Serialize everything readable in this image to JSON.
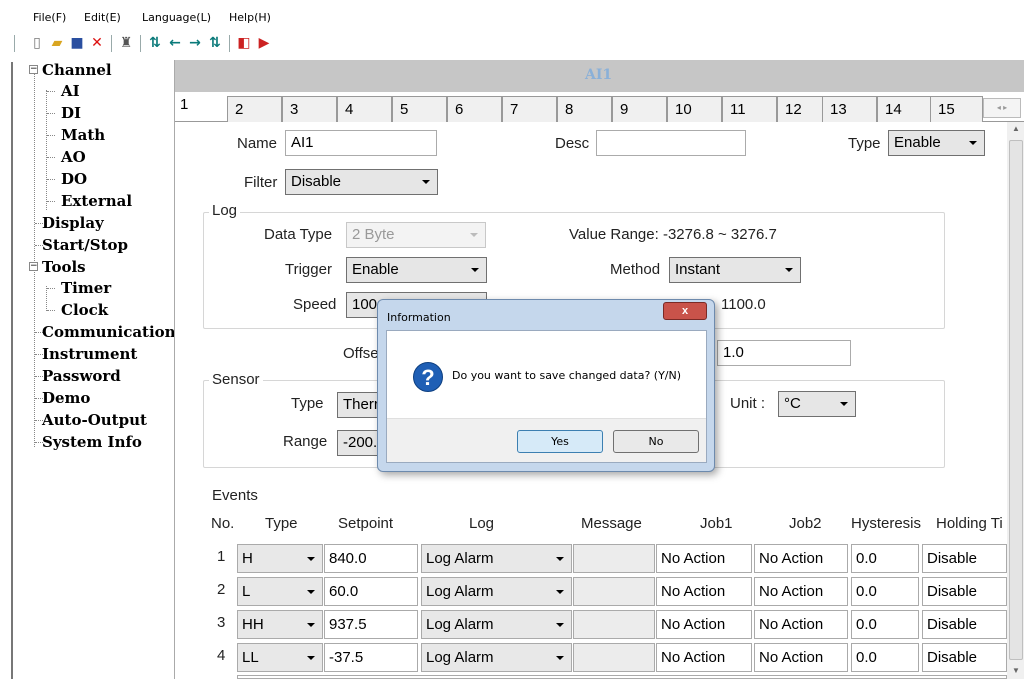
{
  "menubar": {
    "file": "File(F)",
    "edit": "Edit(E)",
    "language": "Language(L)",
    "help": "Help(H)"
  },
  "toolbar": {
    "icons": [
      "new-file-icon",
      "open-folder-icon",
      "save-icon",
      "delete-icon",
      "users-icon",
      "download-icon",
      "arrow-left-icon",
      "arrow-right-icon",
      "upload-icon",
      "import-icon",
      "export-icon"
    ]
  },
  "tree": {
    "channel": "Channel",
    "ai": "AI",
    "di": "DI",
    "math": "Math",
    "ao": "AO",
    "do": "DO",
    "external": "External",
    "display": "Display",
    "startstop": "Start/Stop",
    "tools": "Tools",
    "timer": "Timer",
    "clock": "Clock",
    "communication": "Communication",
    "instrument": "Instrument",
    "password": "Password",
    "demo": "Demo",
    "autooutput": "Auto-Output",
    "sysinfo": "System Info",
    "collapse_glyph": "−"
  },
  "panel": {
    "title": "AI1"
  },
  "tabs": [
    "1",
    "2",
    "3",
    "4",
    "5",
    "6",
    "7",
    "8",
    "9",
    "10",
    "11",
    "12",
    "13",
    "14",
    "15"
  ],
  "form": {
    "name_label": "Name",
    "name_value": "AI1",
    "desc_label": "Desc",
    "desc_value": "",
    "type_label": "Type",
    "type_value": "Enable",
    "filter_label": "Filter",
    "filter_value": "Disable"
  },
  "log": {
    "title": "Log",
    "datatype_label": "Data Type",
    "datatype_value": "2 Byte",
    "valuerange_text": "Value Range: -3276.8 ~ 3276.7",
    "trigger_label": "Trigger",
    "trigger_value": "Enable",
    "method_label": "Method",
    "method_value": "Instant",
    "speed_label": "Speed",
    "speed_value": "100",
    "modbus_partial": "1100.0"
  },
  "offset": {
    "label": "Offse",
    "value": "1.0"
  },
  "sensor": {
    "title": "Sensor",
    "type_label": "Type",
    "type_value": "Therr",
    "range_label": "Range",
    "range_value": "-200.",
    "unit_label": "Unit :",
    "unit_value": "°C"
  },
  "events": {
    "title": "Events",
    "headers": {
      "no": "No.",
      "type": "Type",
      "setpoint": "Setpoint",
      "log": "Log",
      "message": "Message",
      "job1": "Job1",
      "job2": "Job2",
      "hysteresis": "Hysteresis",
      "holding": "Holding Ti"
    },
    "rows": [
      {
        "no": "1",
        "type": "H",
        "setpoint": "840.0",
        "log": "Log Alarm",
        "job1": "No Action",
        "job2": "No Action",
        "hysteresis": "0.0",
        "holding": "Disable"
      },
      {
        "no": "2",
        "type": "L",
        "setpoint": "60.0",
        "log": "Log Alarm",
        "job1": "No Action",
        "job2": "No Action",
        "hysteresis": "0.0",
        "holding": "Disable"
      },
      {
        "no": "3",
        "type": "HH",
        "setpoint": "937.5",
        "log": "Log Alarm",
        "job1": "No Action",
        "job2": "No Action",
        "hysteresis": "0.0",
        "holding": "Disable"
      },
      {
        "no": "4",
        "type": "LL",
        "setpoint": "-37.5",
        "log": "Log Alarm",
        "job1": "No Action",
        "job2": "No Action",
        "hysteresis": "0.0",
        "holding": "Disable"
      }
    ]
  },
  "dialog": {
    "title": "Information",
    "close": "x",
    "icon": "question-icon",
    "icon_glyph": "?",
    "message": "Do you want to save changed data? (Y/N)",
    "yes": "Yes",
    "no": "No"
  },
  "colors": {
    "dialog_frame": "#c5d7ec",
    "close_button": "#c9534a",
    "panel_title": "#8ab0d8"
  }
}
